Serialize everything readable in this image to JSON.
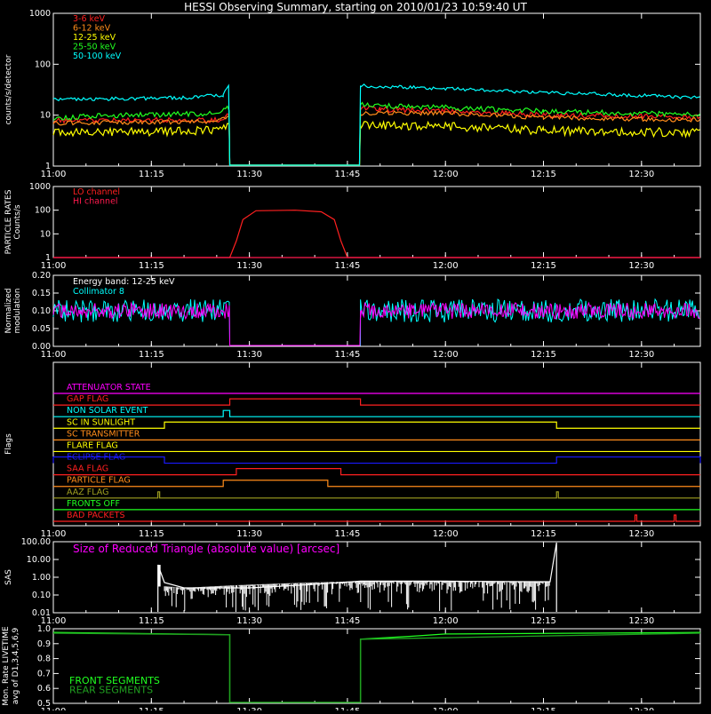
{
  "title": "HESSI Observing Summary, starting on 2010/01/23 10:59:40 UT",
  "colors": {
    "background": "#000000",
    "axes": "#ffffff",
    "red": "#ff2020",
    "orange": "#ff8c1a",
    "yellow": "#ffff00",
    "green": "#20ff20",
    "cyan": "#00ffff",
    "magenta": "#ff00ff",
    "crimson": "#ff1a4d",
    "blue": "#1a1aff",
    "olive": "#a0a020",
    "darkgreen": "#20a020"
  },
  "time_ticks": [
    "11:00",
    "11:15",
    "11:30",
    "11:45",
    "12:00",
    "12:15",
    "12:30"
  ],
  "chart_data": [
    {
      "id": "count-rates",
      "type": "line",
      "ylabel": "counts/s/detector",
      "yscale": "log",
      "ylim": [
        1,
        1000
      ],
      "ytick_labels": [
        "1",
        "10",
        "100",
        "1000"
      ],
      "xlim": [
        "11:00",
        "12:39"
      ],
      "series": [
        {
          "name": "3-6 keV",
          "color": "#ff2020",
          "points": [
            [
              "11:00",
              8
            ],
            [
              "11:25",
              8
            ],
            [
              "11:27",
              10
            ],
            [
              "11:27",
              1
            ],
            [
              "11:47",
              1
            ],
            [
              "11:47",
              14
            ],
            [
              "11:50",
              13
            ],
            [
              "12:00",
              12
            ],
            [
              "12:15",
              10
            ],
            [
              "12:39",
              9
            ]
          ]
        },
        {
          "name": "6-12 keV",
          "color": "#ff8c1a",
          "points": [
            [
              "11:00",
              7
            ],
            [
              "11:25",
              7.5
            ],
            [
              "11:27",
              9
            ],
            [
              "11:27",
              1
            ],
            [
              "11:47",
              1
            ],
            [
              "11:47",
              11
            ],
            [
              "12:00",
              11
            ],
            [
              "12:15",
              9
            ],
            [
              "12:39",
              8
            ]
          ]
        },
        {
          "name": "12-25 keV",
          "color": "#ffff00",
          "points": [
            [
              "11:00",
              4.5
            ],
            [
              "11:25",
              5
            ],
            [
              "11:27",
              6
            ],
            [
              "11:27",
              1
            ],
            [
              "11:47",
              1
            ],
            [
              "11:47",
              6.5
            ],
            [
              "12:00",
              6
            ],
            [
              "12:15",
              5
            ],
            [
              "12:39",
              4.5
            ]
          ]
        },
        {
          "name": "25-50 keV",
          "color": "#20ff20",
          "points": [
            [
              "11:00",
              9
            ],
            [
              "11:25",
              11
            ],
            [
              "11:27",
              14
            ],
            [
              "11:27",
              1
            ],
            [
              "11:47",
              1
            ],
            [
              "11:47",
              16
            ],
            [
              "12:00",
              14
            ],
            [
              "12:15",
              12
            ],
            [
              "12:39",
              10
            ]
          ]
        },
        {
          "name": "50-100 keV",
          "color": "#00ffff",
          "points": [
            [
              "11:00",
              20
            ],
            [
              "11:20",
              22
            ],
            [
              "11:26",
              25
            ],
            [
              "11:27",
              45
            ],
            [
              "11:27",
              1
            ],
            [
              "11:47",
              1
            ],
            [
              "11:47",
              38
            ],
            [
              "12:00",
              33
            ],
            [
              "12:15",
              28
            ],
            [
              "12:39",
              22
            ]
          ]
        }
      ]
    },
    {
      "id": "particle-rates",
      "type": "line",
      "ylabel": "PARTICLE RATES Counts/s",
      "yscale": "log",
      "ylim": [
        1,
        1000
      ],
      "ytick_labels": [
        "1",
        "10",
        "100",
        "1000"
      ],
      "xlim": [
        "11:00",
        "12:39"
      ],
      "series": [
        {
          "name": "LO channel",
          "color": "#ff2020",
          "points": [
            [
              "11:00",
              1
            ],
            [
              "11:27",
              1
            ],
            [
              "11:28",
              5
            ],
            [
              "11:29",
              40
            ],
            [
              "11:31",
              95
            ],
            [
              "11:37",
              100
            ],
            [
              "11:41",
              85
            ],
            [
              "11:43",
              40
            ],
            [
              "11:44",
              5
            ],
            [
              "11:45",
              1
            ],
            [
              "12:39",
              1
            ]
          ]
        },
        {
          "name": "HI channel",
          "color": "#ff1a4d",
          "points": [
            [
              "11:00",
              1
            ],
            [
              "12:39",
              1
            ]
          ]
        }
      ]
    },
    {
      "id": "modulation",
      "type": "line",
      "ylabel": "Normalized modulation",
      "ylim": [
        0,
        0.2
      ],
      "ytick_labels": [
        "0.00",
        "0.05",
        "0.10",
        "0.15",
        "0.20"
      ],
      "xlim": [
        "11:00",
        "12:39"
      ],
      "annotation": "Energy band: 12-25 keV",
      "series": [
        {
          "name": "Collimator 8",
          "color": "#00ffff",
          "points": [
            [
              "11:00",
              0.1
            ],
            [
              "11:27",
              0.1
            ],
            [
              "11:27",
              0
            ],
            [
              "11:47",
              0
            ],
            [
              "11:47",
              0.1
            ],
            [
              "12:39",
              0.1
            ]
          ]
        },
        {
          "name": "",
          "color": "#ff00ff",
          "points": [
            [
              "11:00",
              0.1
            ],
            [
              "11:27",
              0.1
            ],
            [
              "11:27",
              0
            ],
            [
              "11:47",
              0
            ],
            [
              "11:47",
              0.1
            ],
            [
              "12:39",
              0.1
            ]
          ]
        }
      ]
    },
    {
      "id": "flags",
      "type": "line",
      "ylabel": "Flags",
      "xlim": [
        "11:00",
        "12:39"
      ],
      "flags": [
        {
          "name": "ATTENUATOR STATE",
          "color": "#ff00ff",
          "on": []
        },
        {
          "name": "GAP FLAG",
          "color": "#ff2020",
          "on": [
            [
              "11:27",
              "11:47"
            ]
          ]
        },
        {
          "name": "NON SOLAR EVENT",
          "color": "#00ffff",
          "on": [
            [
              "11:26",
              "11:27"
            ]
          ]
        },
        {
          "name": "SC IN SUNLIGHT",
          "color": "#ffff00",
          "on": [
            [
              "11:17",
              "12:17"
            ]
          ]
        },
        {
          "name": "SC TRANSMITTER",
          "color": "#ff8c1a",
          "on": []
        },
        {
          "name": "FLARE FLAG",
          "color": "#ffff00",
          "on": []
        },
        {
          "name": "ECLIPSE FLAG",
          "color": "#1a1aff",
          "on": [
            [
              "11:00",
              "11:17"
            ],
            [
              "12:17",
              "12:39"
            ]
          ]
        },
        {
          "name": "SAA FLAG",
          "color": "#ff2020",
          "on": [
            [
              "11:28",
              "11:44"
            ]
          ]
        },
        {
          "name": "PARTICLE FLAG",
          "color": "#ff8c1a",
          "on": [
            [
              "11:26",
              "11:42"
            ]
          ]
        },
        {
          "name": "AAZ FLAG",
          "color": "#a0a020",
          "on": [
            [
              "11:16",
              "11:16"
            ],
            [
              "12:17",
              "12:17"
            ]
          ]
        },
        {
          "name": "FRONTS OFF",
          "color": "#20ff20",
          "on": []
        },
        {
          "name": "BAD PACKETS",
          "color": "#ff2020",
          "on": [
            [
              "12:29",
              "12:29"
            ],
            [
              "12:35",
              "12:35"
            ]
          ]
        }
      ]
    },
    {
      "id": "sas",
      "type": "line",
      "ylabel": "SAS",
      "yscale": "log",
      "ylim": [
        0.01,
        100
      ],
      "ytick_labels": [
        "0.01",
        "0.10",
        "1.00",
        "10.00",
        "100.00"
      ],
      "xlim": [
        "11:00",
        "12:39"
      ],
      "annotation": "Size of Reduced Triangle (absolute value) [arcsec]",
      "series": [
        {
          "name": "",
          "color": "#ffffff",
          "points": [
            [
              "11:16",
              0.01
            ],
            [
              "11:16",
              5
            ],
            [
              "11:17",
              0.5
            ],
            [
              "11:20",
              0.25
            ],
            [
              "11:30",
              0.25
            ],
            [
              "11:40",
              0.4
            ],
            [
              "11:47",
              0.6
            ],
            [
              "12:00",
              0.6
            ],
            [
              "12:16",
              0.55
            ],
            [
              "12:17",
              100
            ],
            [
              "12:17",
              0.01
            ]
          ]
        }
      ]
    },
    {
      "id": "livetime",
      "type": "line",
      "ylabel": "Mon. Rate LIVETIME avg of D1,3,4,5,6,9",
      "ylim": [
        0.5,
        1.0
      ],
      "ytick_labels": [
        "0.5",
        "0.6",
        "0.7",
        "0.8",
        "0.9",
        "1.0"
      ],
      "xlim": [
        "11:00",
        "12:39"
      ],
      "series": [
        {
          "name": "FRONT SEGMENTS",
          "color": "#20ff20",
          "points": [
            [
              "11:00",
              0.975
            ],
            [
              "11:27",
              0.96
            ],
            [
              "11:27",
              0.5
            ],
            [
              "11:47",
              0.5
            ],
            [
              "11:47",
              0.93
            ],
            [
              "11:55",
              0.95
            ],
            [
              "12:00",
              0.965
            ],
            [
              "12:39",
              0.975
            ]
          ]
        },
        {
          "name": "REAR SEGMENTS",
          "color": "#20a020",
          "points": [
            [
              "11:00",
              0.97
            ],
            [
              "11:27",
              0.96
            ],
            [
              "11:27",
              0.5
            ],
            [
              "11:47",
              0.5
            ],
            [
              "11:47",
              0.93
            ],
            [
              "12:39",
              0.97
            ]
          ]
        }
      ]
    }
  ]
}
